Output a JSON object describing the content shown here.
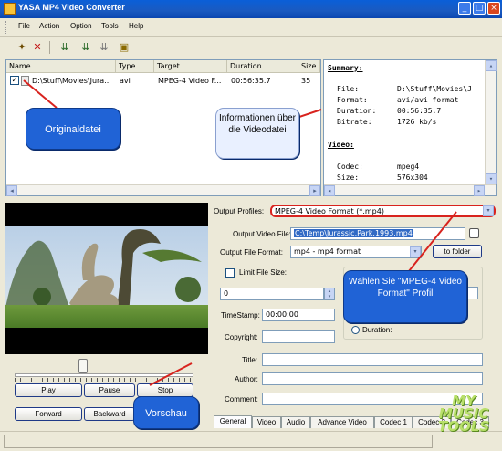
{
  "window": {
    "title": "YASA MP4 Video Converter"
  },
  "menu": [
    "File",
    "Action",
    "Option",
    "Tools",
    "Help"
  ],
  "toolbar_icons": [
    "add-file-icon",
    "remove-icon",
    "convert-icon",
    "convert-all-icon",
    "profile-icon"
  ],
  "filelist": {
    "columns": [
      "Name",
      "Type",
      "Target",
      "Duration",
      "Size"
    ],
    "rows": [
      {
        "name": "D:\\Stuff\\Movies\\Jura...",
        "type": "avi",
        "target": "MPEG-4 Video F...",
        "duration": "00:56:35.7",
        "size": "35"
      }
    ]
  },
  "summary": {
    "title": "Summary:",
    "lines": [
      {
        "k": "File:",
        "v": "D:\\Stuff\\Movies\\J"
      },
      {
        "k": "Format:",
        "v": "avi/avi format"
      },
      {
        "k": "Duration:",
        "v": "00:56:35.7"
      },
      {
        "k": "Bitrate:",
        "v": "1726 kb/s"
      }
    ],
    "video_title": "Video:",
    "video_lines": [
      {
        "k": "Codec:",
        "v": "mpeg4"
      },
      {
        "k": "Size:",
        "v": "576x304"
      }
    ]
  },
  "player": {
    "play": "Play",
    "pause": "Pause",
    "stop": "Stop",
    "forward": "Forward",
    "backward": "Backward"
  },
  "output": {
    "profiles_label": "Output Profiles:",
    "profile_value": "MPEG-4 Video Format (*.mp4)",
    "file_label": "Output Video File:",
    "file_value": "C:\\Temp\\Jurassic.Park.1993.mp4",
    "format_label": "Output File Format:",
    "format_value": "mp4 - mp4 format",
    "to_folder": "to folder",
    "limit_label": "Limit File Size:",
    "limit_value": "0",
    "timestamp_label": "TimeStamp:",
    "timestamp_value": "00:00:00",
    "copyright_label": "Copyright:",
    "title_label": "Title:",
    "author_label": "Author:",
    "comment_label": "Comment:",
    "duration_label": "Duration:"
  },
  "tabs": [
    "General",
    "Video",
    "Audio",
    "Advance Video",
    "Codec 1",
    "Codec 2",
    "Codec 3"
  ],
  "callouts": {
    "originaldatei": "Originaldatei",
    "informationen": "Informationen über die Videodatei",
    "waehlen": "Wählen Sie \"MPEG-4 Video Format\" Profil",
    "vorschau": "Vorschau"
  },
  "watermark": "MY MUSIC TOOLS",
  "colors": {
    "titlebar": "#0a5fd8",
    "callout": "#2063d6",
    "selection": "#316ac5",
    "highlight": "#d8231e"
  }
}
